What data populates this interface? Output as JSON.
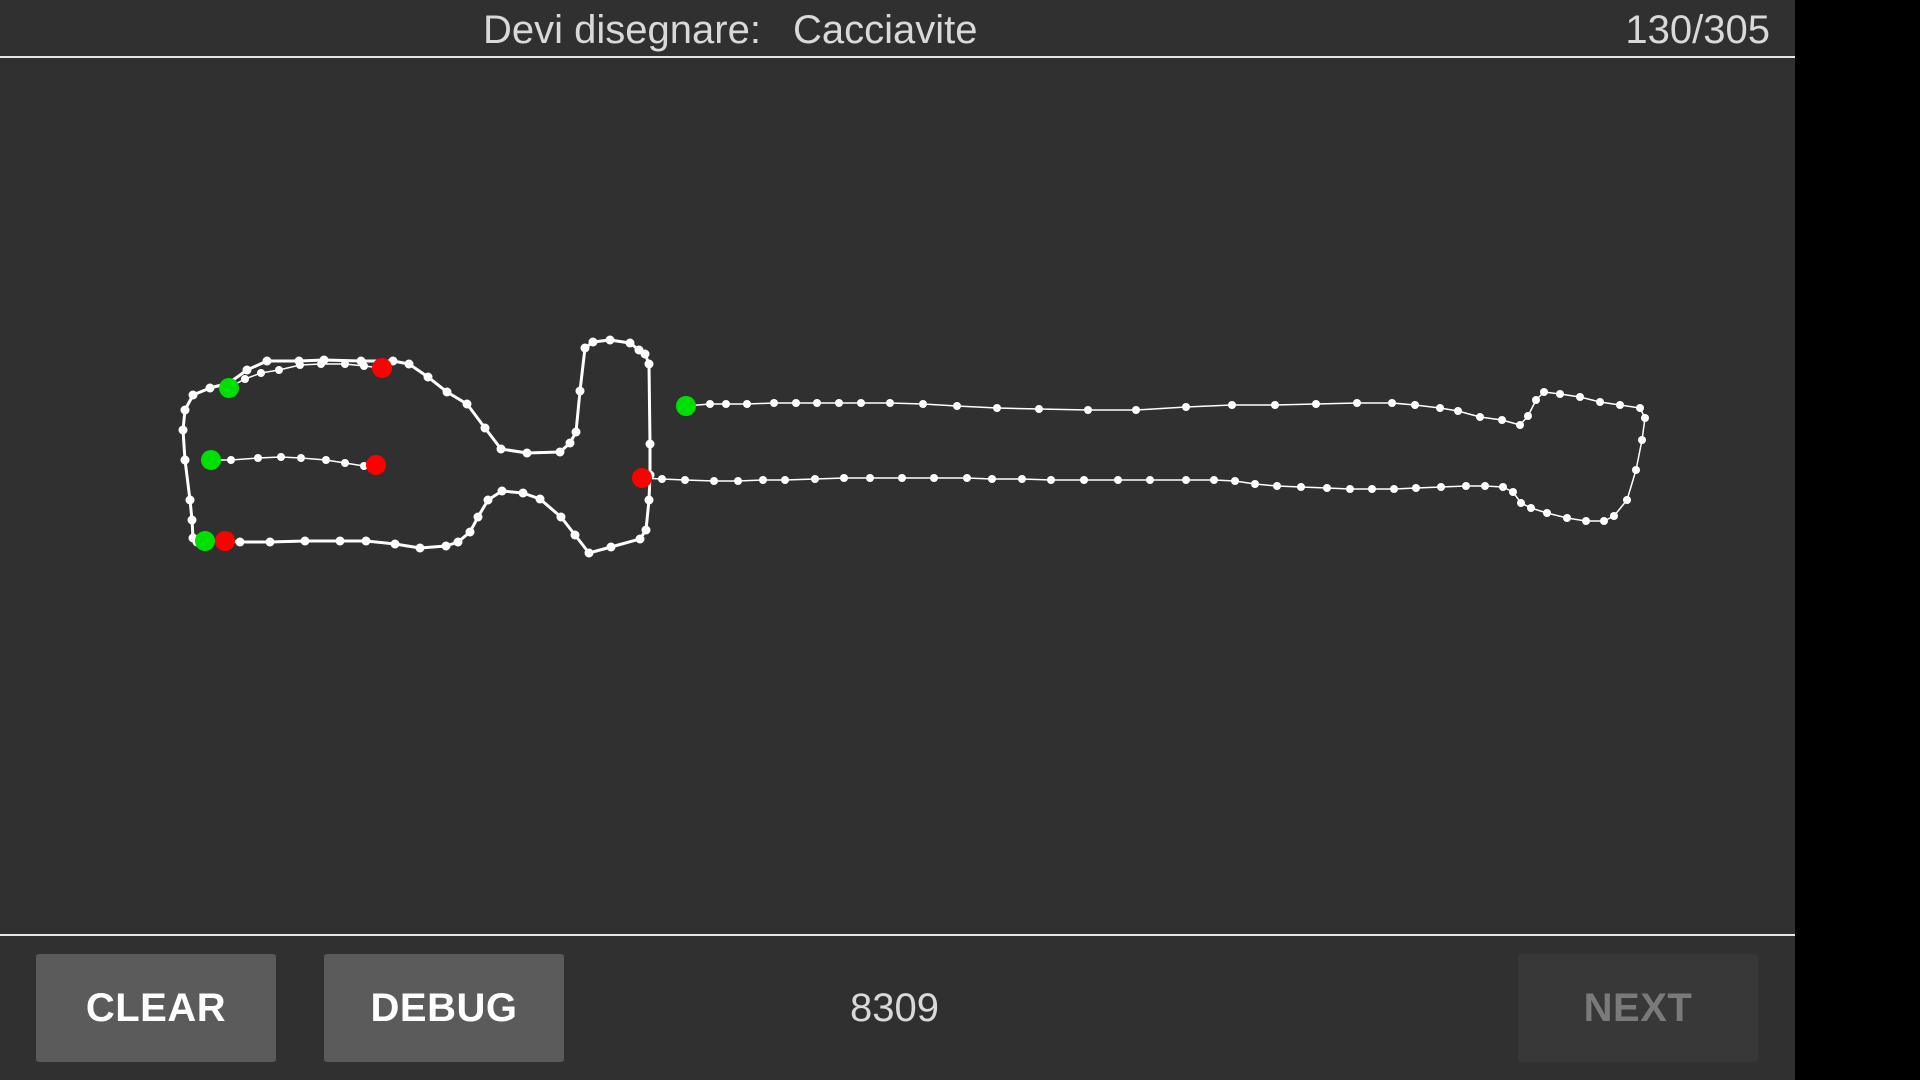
{
  "header": {
    "prompt_label": "Devi disegnare:",
    "prompt_word": "Cacciavite",
    "progress": "130/305"
  },
  "footer": {
    "clear_label": "CLEAR",
    "debug_label": "DEBUG",
    "score": "8309",
    "next_label": "NEXT"
  },
  "colors": {
    "background": "#303030",
    "stroke": "#ffffff",
    "stroke_start": "#00e000",
    "stroke_end": "#ff0000"
  }
}
